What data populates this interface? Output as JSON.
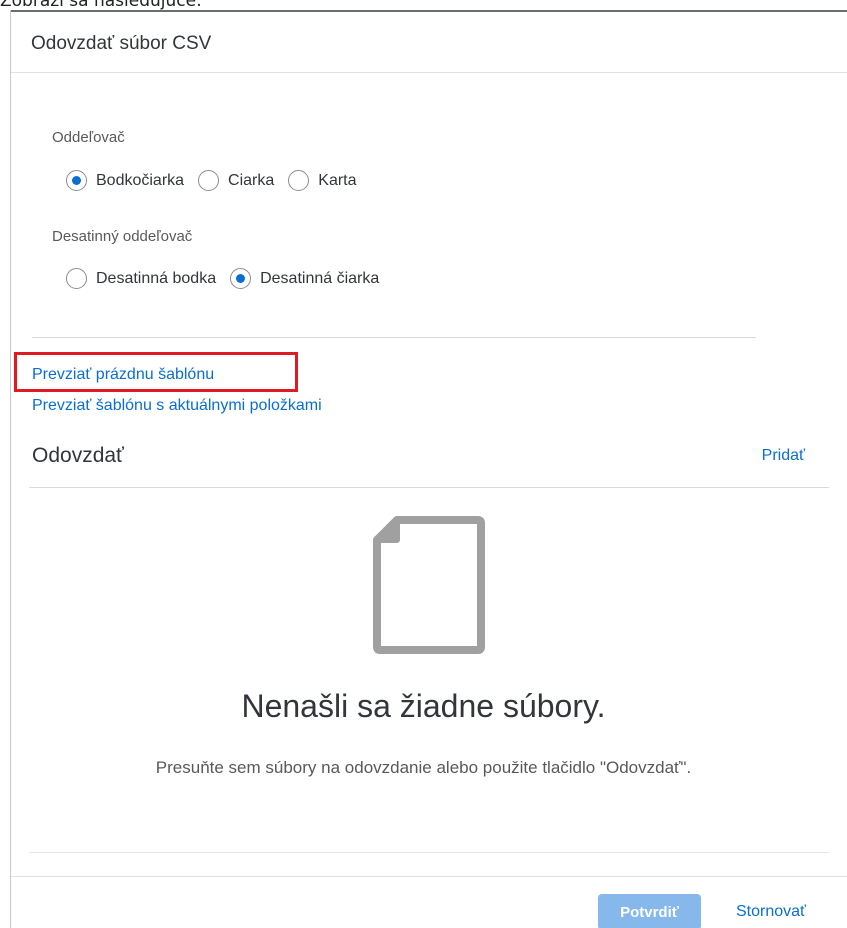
{
  "caption": {
    "text": "Zobrazí sa nasledujúce:"
  },
  "dialog": {
    "title": "Odovzdať súbor CSV"
  },
  "separator": {
    "label": "Oddeľovač",
    "options": [
      {
        "label": "Bodkočiarka",
        "selected": true
      },
      {
        "label": "Ciarka",
        "selected": false
      },
      {
        "label": "Karta",
        "selected": false
      }
    ]
  },
  "decimal_separator": {
    "label": "Desatinný oddeľovač",
    "options": [
      {
        "label": "Desatinná bodka",
        "selected": false
      },
      {
        "label": "Desatinná čiarka",
        "selected": true
      }
    ]
  },
  "links": {
    "empty_template": "Prevziať prázdnu šablónu",
    "current_template": "Prevziať šablónu s aktuálnymi položkami"
  },
  "upload": {
    "title": "Odovzdať",
    "add_label": "Pridať",
    "empty_title": "Nenašli sa žiadne súbory.",
    "empty_description": "Presuňte sem súbory na odovzdanie alebo použite tlačidlo \"Odovzdať\"."
  },
  "footer": {
    "confirm_label": "Potvrdiť",
    "cancel_label": "Stornovať"
  },
  "colors": {
    "accent": "#0a6ed1",
    "highlight": "#e01a22",
    "confirm_disabled": "#86b8ec",
    "icon_gray": "#a0a0a0"
  },
  "icons": {
    "radio_selected": "radio-selected-icon",
    "radio_unselected": "radio-unselected-icon",
    "empty_state": "document-icon"
  }
}
